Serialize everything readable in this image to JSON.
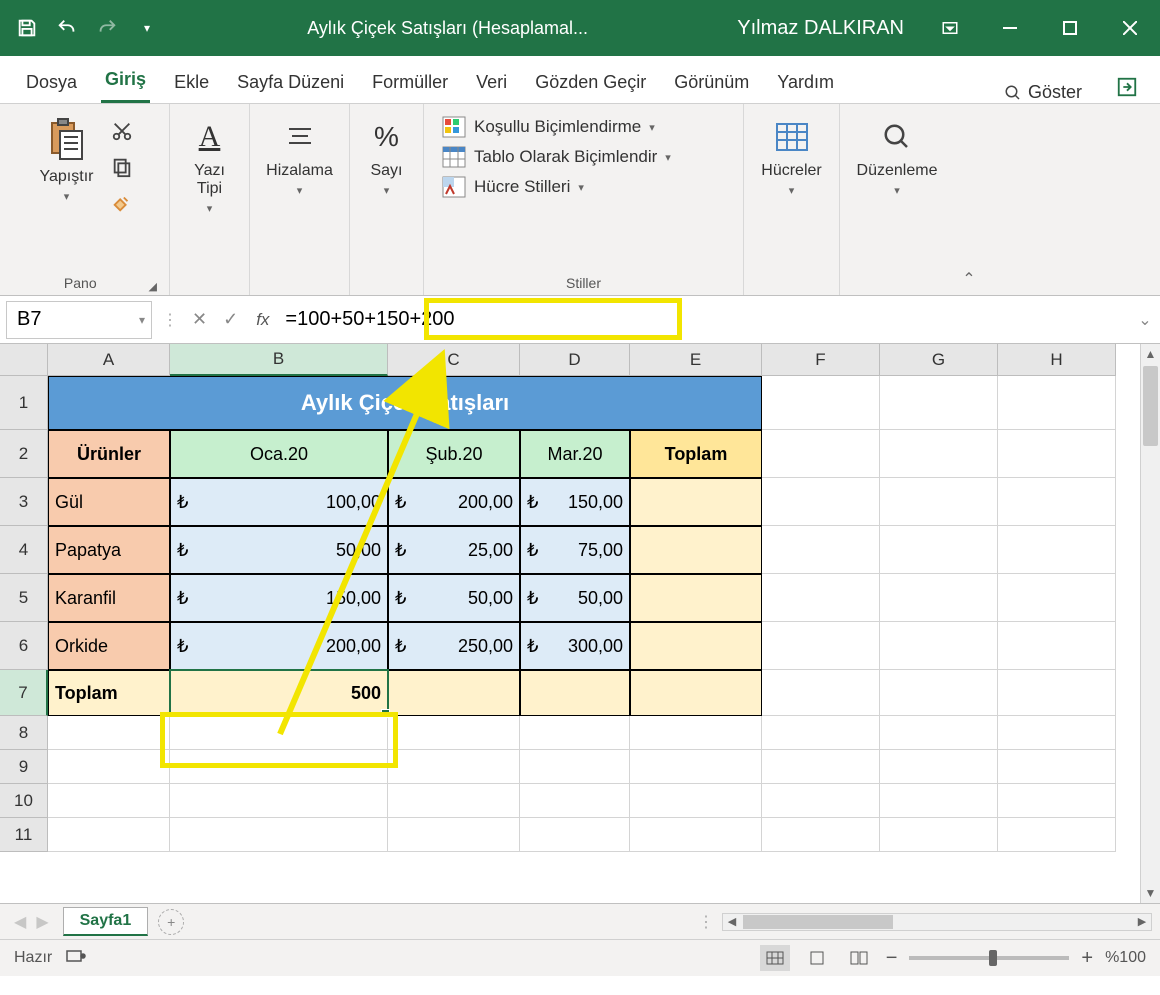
{
  "titlebar": {
    "document_title": "Aylık Çiçek Satışları (Hesaplamal...",
    "user_name": "Yılmaz DALKIRAN"
  },
  "tabs": {
    "file": "Dosya",
    "home": "Giriş",
    "insert": "Ekle",
    "page_layout": "Sayfa Düzeni",
    "formulas": "Formüller",
    "data": "Veri",
    "review": "Gözden Geçir",
    "view": "Görünüm",
    "help": "Yardım",
    "tell_me": "Göster"
  },
  "ribbon": {
    "clipboard": {
      "label": "Pano",
      "paste": "Yapıştır"
    },
    "font": {
      "label": "Yazı\nTipi"
    },
    "alignment": {
      "label": "Hizalama"
    },
    "number": {
      "label": "Sayı"
    },
    "styles": {
      "label": "Stiller",
      "conditional": "Koşullu Biçimlendirme",
      "table": "Tablo Olarak Biçimlendir",
      "cell": "Hücre Stilleri"
    },
    "cells": {
      "label": "Hücreler"
    },
    "editing": {
      "label": "Düzenleme"
    }
  },
  "formula_bar": {
    "name_box": "B7",
    "formula": "=100+50+150+200"
  },
  "columns": [
    "A",
    "B",
    "C",
    "D",
    "E",
    "F",
    "G",
    "H"
  ],
  "row_nums": [
    "1",
    "2",
    "3",
    "4",
    "5",
    "6",
    "7",
    "8",
    "9",
    "10",
    "11"
  ],
  "sheet": {
    "title": "Aylık Çiçek Satışları",
    "hdr_products": "Ürünler",
    "months": [
      "Oca.20",
      "Şub.20",
      "Mar.20"
    ],
    "hdr_total": "Toplam",
    "hdr_total_row": "Toplam",
    "currency": "₺",
    "rows": [
      {
        "name": "Gül",
        "vals": [
          "100,00",
          "200,00",
          "150,00"
        ]
      },
      {
        "name": "Papatya",
        "vals": [
          "50,00",
          "25,00",
          "75,00"
        ]
      },
      {
        "name": "Karanfil",
        "vals": [
          "150,00",
          "50,00",
          "50,00"
        ]
      },
      {
        "name": "Orkide",
        "vals": [
          "200,00",
          "250,00",
          "300,00"
        ]
      }
    ],
    "total_b": "500"
  },
  "sheet_tab": "Sayfa1",
  "status": {
    "ready": "Hazır",
    "zoom": "%100"
  }
}
